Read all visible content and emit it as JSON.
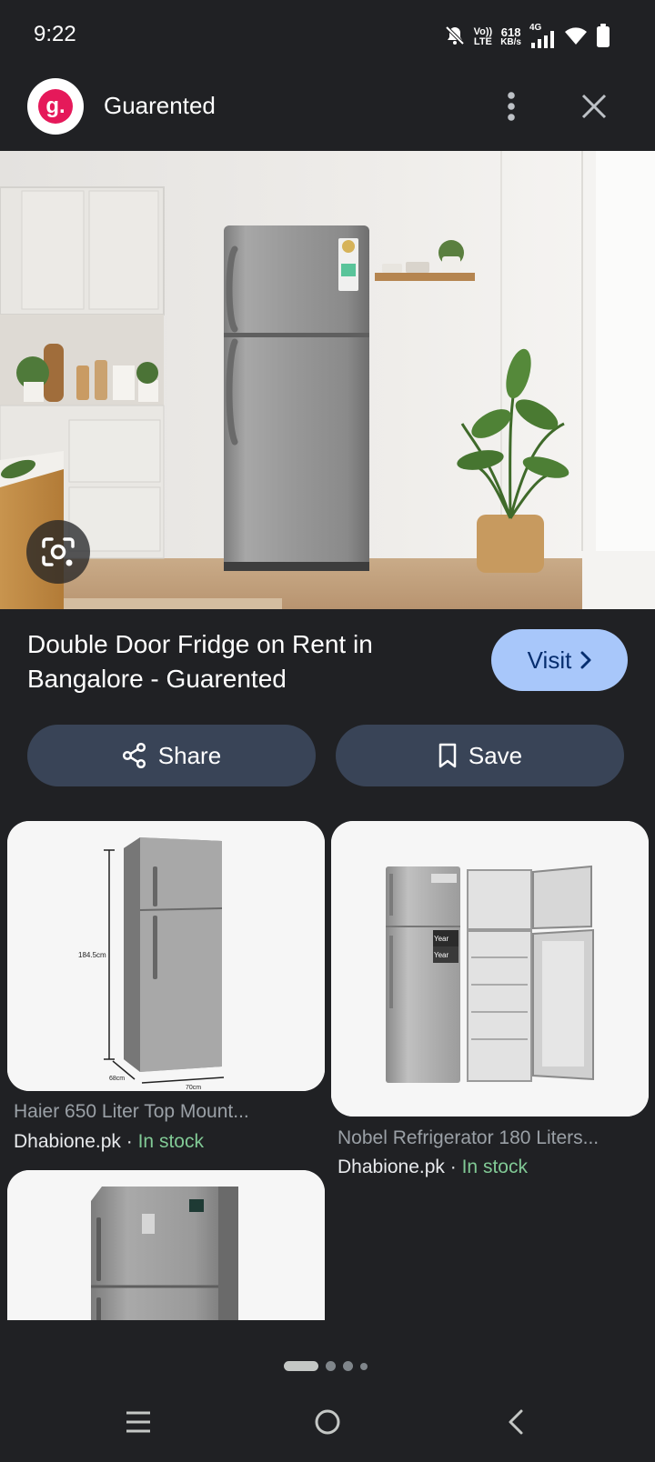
{
  "status_bar": {
    "time": "9:22",
    "volte_top": "Vo))",
    "volte_bottom": "LTE",
    "speed_value": "618",
    "speed_unit": "KB/s",
    "network": "4G",
    "icons": [
      "mute-icon",
      "signal-icon",
      "wifi-icon",
      "battery-icon"
    ]
  },
  "header": {
    "site_name": "Guarented",
    "logo_letter": "g.",
    "icons": [
      "more-vert-icon",
      "close-icon"
    ]
  },
  "hero": {
    "title": "Double Door Fridge on Rent in Bangalore - Guarented",
    "visit_label": "Visit",
    "lens_icon": "google-lens-icon"
  },
  "actions": {
    "share_label": "Share",
    "save_label": "Save"
  },
  "results": [
    {
      "title": "Haier 650 Liter Top Mount...",
      "source": "Dhabione.pk",
      "separator": " · ",
      "stock": "In stock",
      "dimension_height": "184.5cm",
      "dimension_depth": "68cm",
      "dimension_width": "70cm"
    },
    {
      "title": "Nobel Refrigerator 180 Liters...",
      "source": "Dhabione.pk",
      "separator": " · ",
      "stock": "In stock",
      "badge_top": "Year",
      "badge_bottom": "Year"
    },
    {
      "title": "",
      "source": "",
      "stock": ""
    }
  ],
  "pager": {
    "count": 4,
    "active_index": 0
  },
  "nav": {
    "icons": [
      "recents-icon",
      "home-icon",
      "back-icon"
    ]
  },
  "colors": {
    "background": "#202124",
    "accent_button": "#a8c7fa",
    "action_button": "#394457",
    "stock_green": "#81c995",
    "brand_pink": "#e5195a"
  }
}
